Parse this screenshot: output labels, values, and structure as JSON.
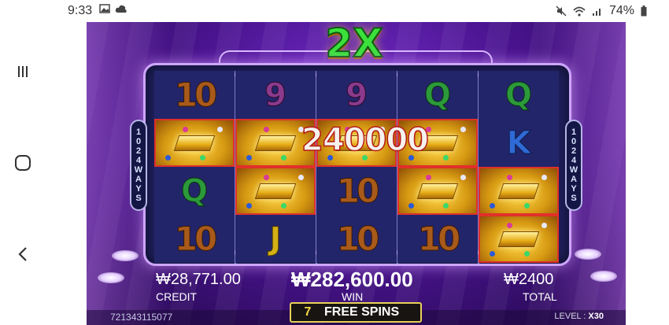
{
  "status_bar": {
    "time": "9:33",
    "battery": "74%",
    "icons": [
      "image-icon",
      "cloud-icon",
      "mute-icon",
      "wifi-icon",
      "signal-icon",
      "battery-icon"
    ]
  },
  "nav": {
    "buttons": [
      "recent-apps-icon",
      "home-icon",
      "back-icon"
    ]
  },
  "game": {
    "multiplier": "2X",
    "ways_label": [
      "1",
      "0",
      "2",
      "4",
      "W",
      "A",
      "Y",
      "S"
    ],
    "win_popup": "240000",
    "reels": [
      [
        "10",
        "gold",
        "Q",
        "10"
      ],
      [
        "9",
        "gold",
        "gold",
        "J"
      ],
      [
        "9",
        "gold",
        "10",
        "10"
      ],
      [
        "Q",
        "gold",
        "gold",
        "10"
      ],
      [
        "Q",
        "K",
        "gold",
        "gold"
      ]
    ],
    "credit_amount": "₩28,771.00",
    "credit_label": "CREDIT",
    "win_amount": "₩282,600.00",
    "win_label": "WIN",
    "total_amount": "₩2400",
    "total_label": "TOTAL",
    "free_spins_count": "7",
    "free_spins_label": "FREE SPINS",
    "game_id": "721343115077",
    "level_label": "LEVEL :",
    "level_value": "X30"
  },
  "colors": {
    "background_purple": "#4a1490",
    "win_highlight": "#e0302a",
    "multiplier_green": "#3be03b",
    "free_spins_border": "#e8d058"
  }
}
